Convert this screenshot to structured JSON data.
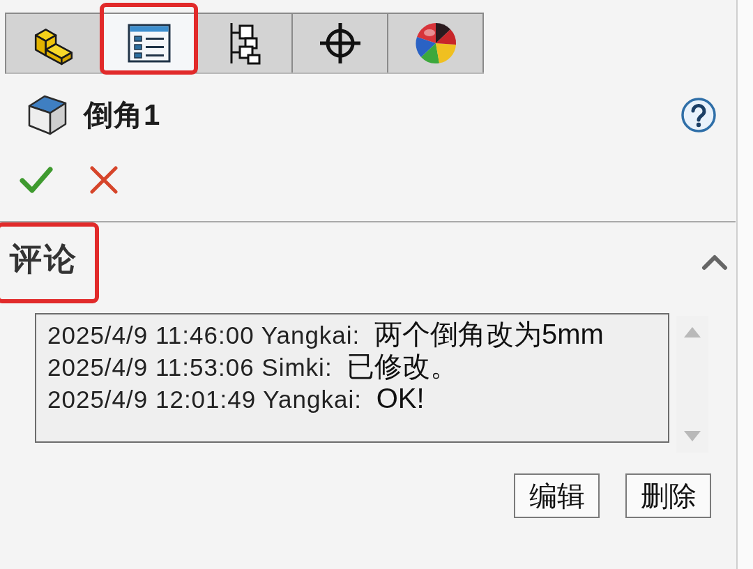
{
  "tabs": [
    {
      "kind": "parts",
      "selected": false,
      "highlighted": false
    },
    {
      "kind": "properties",
      "selected": true,
      "highlighted": true
    },
    {
      "kind": "tree",
      "selected": false,
      "highlighted": false
    },
    {
      "kind": "crosshair",
      "selected": false,
      "highlighted": false
    },
    {
      "kind": "appearance",
      "selected": false,
      "highlighted": false
    }
  ],
  "feature": {
    "title": "倒角1"
  },
  "comments": {
    "title": "评论",
    "expanded": true,
    "highlighted": true,
    "entries": [
      {
        "time": "2025/4/9 11:46:00",
        "author": "Yangkai:",
        "message": "两个倒角改为5mm"
      },
      {
        "time": "2025/4/9 11:53:06",
        "author": "Simki:",
        "message": "已修改。"
      },
      {
        "time": "2025/4/9 12:01:49",
        "author": "Yangkai:",
        "message": "OK!"
      }
    ],
    "buttons": [
      "编辑",
      "删除"
    ]
  }
}
